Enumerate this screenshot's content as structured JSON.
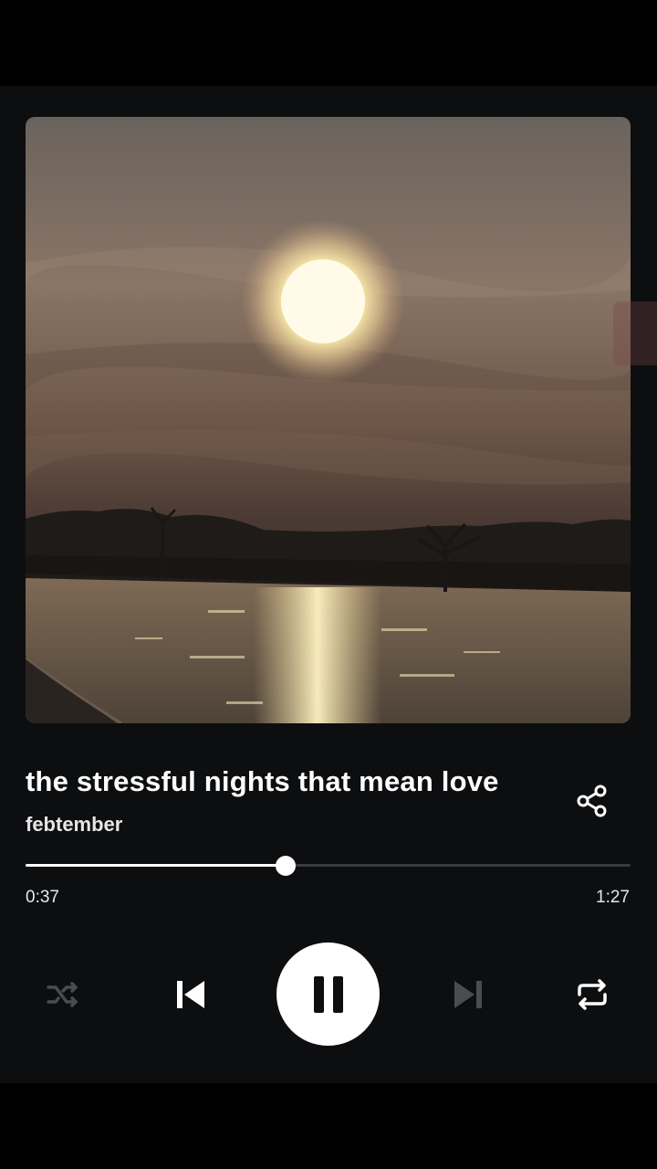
{
  "track": {
    "title": "the stressful nights that mean love",
    "artist": "febtember"
  },
  "playback": {
    "elapsed": "0:37",
    "total": "1:27",
    "progress_fraction": 0.43,
    "state": "playing"
  },
  "controls": {
    "shuffle_icon": "shuffle-icon",
    "shuffle_active": false,
    "previous_icon": "skip-previous-icon",
    "play_pause_icon": "pause-icon",
    "next_icon": "skip-next-icon",
    "next_enabled": false,
    "repeat_icon": "repeat-icon",
    "share_icon": "share-icon"
  },
  "colors": {
    "background": "#0d0e10",
    "accent": "#ffffff",
    "track_inactive": "#3a3b3e",
    "disabled_icon": "#4a4c50"
  }
}
